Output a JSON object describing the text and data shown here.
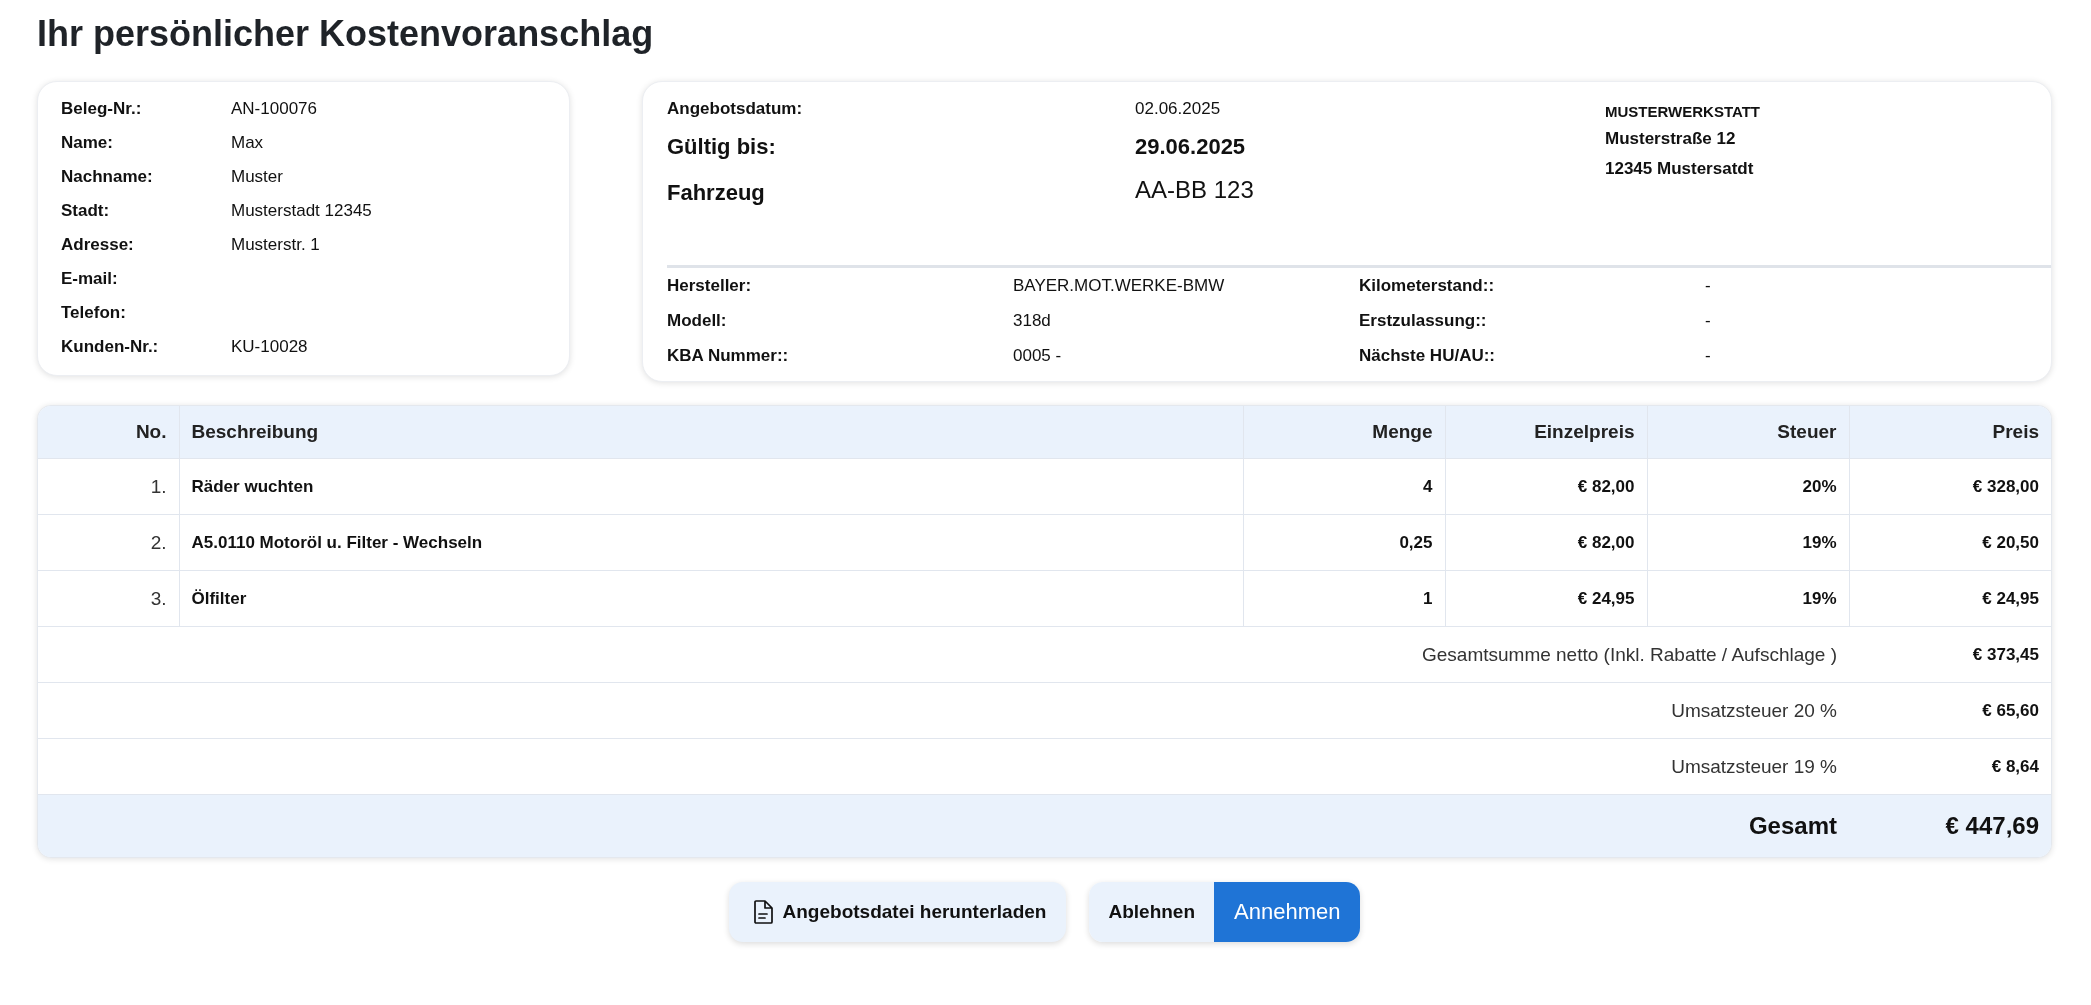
{
  "title": "Ihr persönlicher Kostenvoranschlag",
  "customer": {
    "fields": [
      {
        "label": "Beleg-Nr.:",
        "value": "AN-100076"
      },
      {
        "label": "Name:",
        "value": "Max"
      },
      {
        "label": "Nachname:",
        "value": "Muster"
      },
      {
        "label": "Stadt:",
        "value": "Musterstadt 12345"
      },
      {
        "label": "Adresse:",
        "value": "Musterstr. 1"
      },
      {
        "label": "E-mail:"
      },
      {
        "label": "Telefon:"
      },
      {
        "label": "Kunden-Nr.:",
        "value": "KU-10028"
      }
    ]
  },
  "offer": {
    "header": [
      {
        "label": "Angebotsdatum:",
        "value": "02.06.2025",
        "kind": "date"
      },
      {
        "label": "Gültig bis:",
        "value": "29.06.2025",
        "kind": "deadline"
      },
      {
        "label": "Fahrzeug",
        "value": "AA-BB 123",
        "kind": "vehicle"
      }
    ],
    "workshop": {
      "name": "MUSTERWERKSTATT",
      "lines": [
        "Musterstraße 12",
        "12345 Mustersatdt"
      ]
    },
    "vehicle_rows": [
      [
        {
          "label": "Hersteller:",
          "value": "BAYER.MOT.WERKE-BMW"
        },
        {
          "label": "Kilometerstand::",
          "value": "-"
        }
      ],
      [
        {
          "label": "Modell:",
          "value": "318d"
        },
        {
          "label": "Erstzulassung::",
          "value": "-"
        }
      ],
      [
        {
          "label": "KBA Nummer::",
          "value": "0005 -"
        },
        {
          "label": "Nächste HU/AU::",
          "value": "-"
        }
      ]
    ]
  },
  "table": {
    "columns": [
      "No.",
      "Beschreibung",
      "Menge",
      "Einzelpreis",
      "Steuer",
      "Preis"
    ],
    "rows": [
      {
        "no": "1.",
        "description": "Räder wuchten",
        "quantity": "4",
        "unit_price": "€ 82,00",
        "tax": "20%",
        "price": "€ 328,00"
      },
      {
        "no": "2.",
        "description": "A5.0110 Motoröl u. Filter - Wechseln",
        "quantity": "0,25",
        "unit_price": "€ 82,00",
        "tax": "19%",
        "price": "€ 20,50"
      },
      {
        "no": "3.",
        "description": "Ölfilter",
        "quantity": "1",
        "unit_price": "€ 24,95",
        "tax": "19%",
        "price": "€ 24,95"
      }
    ],
    "summary": [
      {
        "label": "Gesamtsumme netto (Inkl. Rabatte / Aufschlage )",
        "value": "€ 373,45",
        "kind": "subtotal"
      },
      {
        "label": "Umsatzsteuer 20 %",
        "value": "€ 65,60",
        "kind": "subtotal"
      },
      {
        "label": "Umsatzsteuer 19 %",
        "value": "€ 8,64",
        "kind": "subtotal"
      },
      {
        "label": "Gesamt",
        "value": "€ 447,69",
        "kind": "total"
      }
    ]
  },
  "actions": {
    "download": {
      "label": "Angebotsdatei herunterladen"
    },
    "decision": [
      {
        "label": "Ablehnen",
        "kind": "reject"
      },
      {
        "label": "Annehmen",
        "kind": "accept"
      }
    ]
  }
}
